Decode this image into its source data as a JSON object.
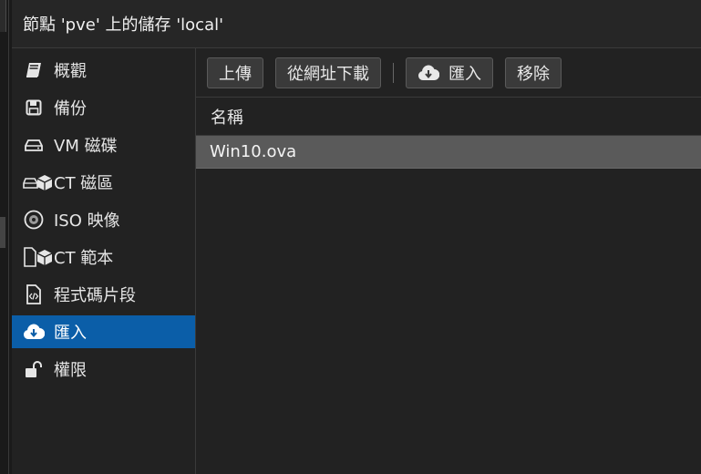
{
  "window": {
    "title": "節點 'pve' 上的儲存 'local'"
  },
  "sidebar": {
    "items": [
      {
        "label": "概觀",
        "icon": "book-icon",
        "active": false
      },
      {
        "label": "備份",
        "icon": "floppy-icon",
        "active": false
      },
      {
        "label": "VM 磁碟",
        "icon": "hdd-icon",
        "active": false
      },
      {
        "label": "CT 磁區",
        "icon": "hdd-cube-icon",
        "active": false
      },
      {
        "label": "ISO 映像",
        "icon": "disc-icon",
        "active": false
      },
      {
        "label": "CT 範本",
        "icon": "file-cube-icon",
        "active": false
      },
      {
        "label": "程式碼片段",
        "icon": "file-code-icon",
        "active": false
      },
      {
        "label": "匯入",
        "icon": "cloud-download-icon",
        "active": true
      },
      {
        "label": "權限",
        "icon": "unlock-icon",
        "active": false
      }
    ]
  },
  "toolbar": {
    "upload_label": "上傳",
    "download_url_label": "從網址下載",
    "import_label": "匯入",
    "remove_label": "移除"
  },
  "grid": {
    "column_name": "名稱",
    "rows": [
      {
        "name": "Win10.ova",
        "selected": true
      }
    ]
  },
  "colors": {
    "active_bg": "#0b5ea8",
    "selected_row_bg": "#5a5a5a"
  }
}
